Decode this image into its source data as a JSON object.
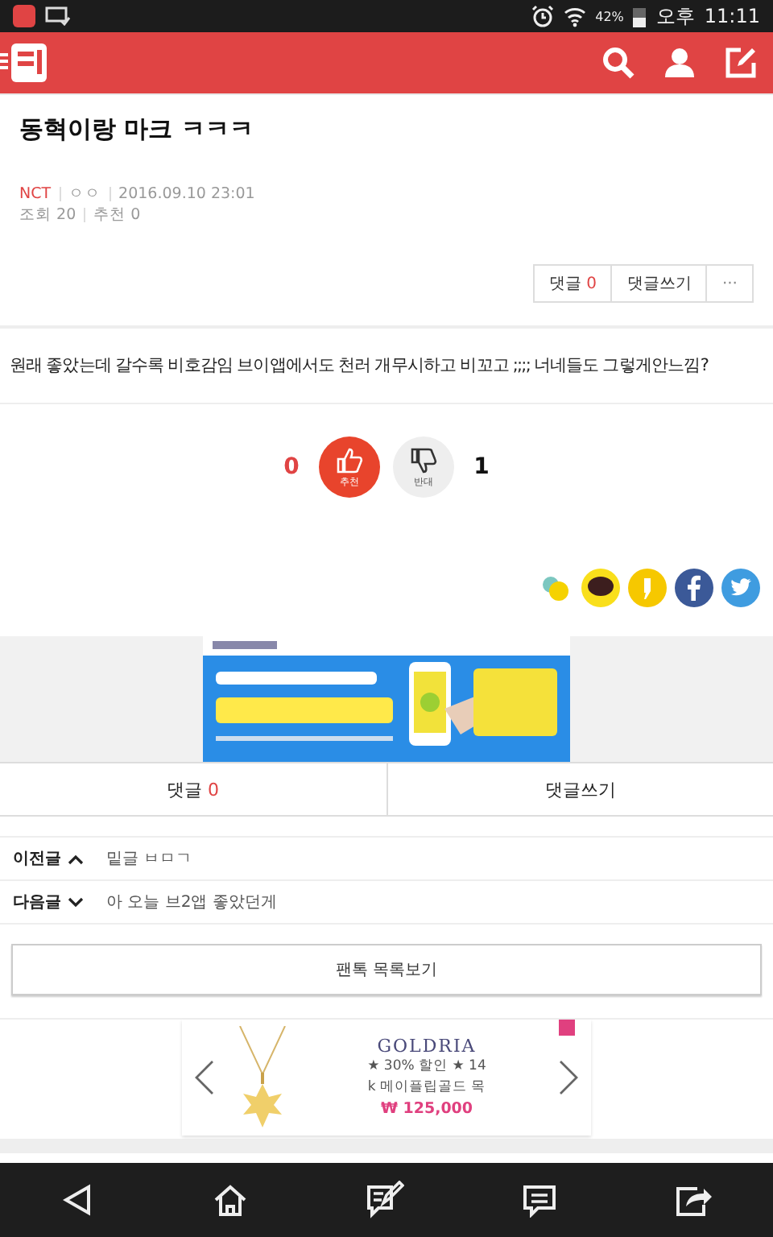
{
  "status_bar": {
    "battery": "42%",
    "period": "오후",
    "time": "11:11"
  },
  "post": {
    "title": "동혁이랑 마크 ㅋㅋㅋ",
    "board": "NCT",
    "author": "ㅇㅇ",
    "date": "2016.09.10 23:01",
    "views": "조회 20",
    "recommends": "추천 0",
    "body": "원래 좋았는데 갈수록 비호감임 브이앱에서도 천러 개무시하고 비꼬고 ;;;; 너네들도 그렇게안느낌?"
  },
  "post_actions": {
    "comments_label": "댓글",
    "comments_count": "0",
    "write": "댓글쓰기",
    "more": "···"
  },
  "votes": {
    "up_count": "0",
    "up_label": "추천",
    "down_label": "반대",
    "down_count": "1"
  },
  "comment_bar": {
    "comments_label": "댓글",
    "comments_count": "0",
    "write": "댓글쓰기"
  },
  "neighbors": [
    {
      "label": "이전글",
      "kind": "previous",
      "title": "밑글 ㅂㅁㄱ"
    },
    {
      "label": "다음글",
      "kind": "next",
      "title": "아 오늘 브2앱 좋았던게"
    }
  ],
  "list_button": "팬톡 목록보기",
  "product_ad": {
    "brand": "GOLDRIA",
    "line1": "★ 30% 할인 ★ 14",
    "line2": "k 메이플립골드 목",
    "price": "₩ 125,000"
  }
}
